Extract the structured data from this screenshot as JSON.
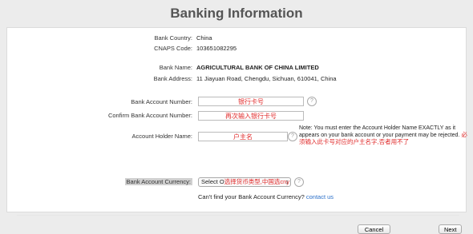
{
  "title": "Banking Information",
  "bank_info": {
    "country_label": "Bank Country:",
    "country_value": "China",
    "cnaps_label": "CNAPS Code:",
    "cnaps_value": "103651082295",
    "name_label": "Bank Name:",
    "name_value": "AGRICULTURAL BANK OF CHINA LIMITED",
    "address_label": "Bank Address:",
    "address_value": "11 Jiayuan Road, Chengdu, Sichuan, 610041, China"
  },
  "form": {
    "account_number_label": "Bank Account Number:",
    "account_number_value": "银行卡号",
    "confirm_label": "Confirm Bank Account Number:",
    "confirm_value": "再次输入银行卡号",
    "holder_label": "Account Holder Name:",
    "holder_value": "户主名",
    "note": "Note: You must enter the Account Holder Name EXACTLY as it appears on your bank account or your payment may be rejected.",
    "note_chinese": "必须输入此卡号对应的户主名字,否者用不了",
    "currency_label": "Bank Account Currency:",
    "currency_select_prefix": "Select O",
    "currency_select_red": "选择货币类型,中国选cny",
    "currency_select_arrow": "↕",
    "help_glyph": "?",
    "cant_find_text": "Can't find your Bank Account Currency?",
    "contact_link": "contact us"
  },
  "buttons": {
    "cancel": "Cancel",
    "next": "Next"
  }
}
